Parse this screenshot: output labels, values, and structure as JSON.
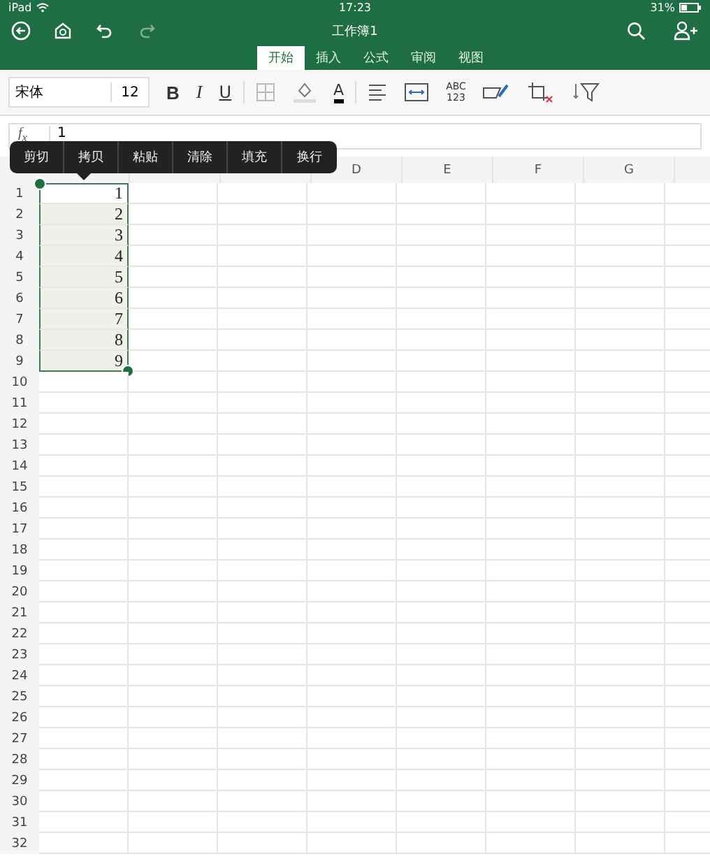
{
  "status_bar": {
    "device": "iPad",
    "time": "17:23",
    "battery": "31%"
  },
  "window": {
    "title": "工作簿1"
  },
  "tabs": [
    {
      "label": "开始",
      "selected": true
    },
    {
      "label": "插入",
      "selected": false
    },
    {
      "label": "公式",
      "selected": false
    },
    {
      "label": "审阅",
      "selected": false
    },
    {
      "label": "视图",
      "selected": false
    }
  ],
  "toolbar": {
    "font": "宋体",
    "size": "12",
    "bold": "B",
    "italic": "I",
    "underline": "U",
    "font_color": "A",
    "number_format": "ABC\n123"
  },
  "formula_bar": {
    "label": "f$_{x}$",
    "value": "1"
  },
  "context_menu": [
    {
      "label": "剪切"
    },
    {
      "label": "拷贝"
    },
    {
      "label": "粘贴"
    },
    {
      "label": "清除"
    },
    {
      "label": "填充"
    },
    {
      "label": "换行"
    }
  ],
  "column_headers": [
    "D",
    "E",
    "F",
    "G"
  ],
  "rows": [
    {
      "label": "1",
      "value": "1",
      "selected": true
    },
    {
      "label": "2",
      "value": "2",
      "selected": true
    },
    {
      "label": "3",
      "value": "3",
      "selected": true
    },
    {
      "label": "4",
      "value": "4",
      "selected": true
    },
    {
      "label": "5",
      "value": "5",
      "selected": true
    },
    {
      "label": "6",
      "value": "6",
      "selected": true
    },
    {
      "label": "7",
      "value": "7",
      "selected": true
    },
    {
      "label": "8",
      "value": "8",
      "selected": true
    },
    {
      "label": "9",
      "value": "9",
      "selected": true
    },
    {
      "label": "10"
    },
    {
      "label": "11"
    },
    {
      "label": "12"
    },
    {
      "label": "13"
    },
    {
      "label": "14"
    },
    {
      "label": "15"
    },
    {
      "label": "16"
    },
    {
      "label": "17"
    },
    {
      "label": "18"
    },
    {
      "label": "19"
    },
    {
      "label": "20"
    },
    {
      "label": "21"
    },
    {
      "label": "22"
    },
    {
      "label": "23"
    },
    {
      "label": "24"
    },
    {
      "label": "25"
    },
    {
      "label": "26"
    },
    {
      "label": "27"
    },
    {
      "label": "28"
    },
    {
      "label": "29"
    },
    {
      "label": "30"
    },
    {
      "label": "31"
    },
    {
      "label": "32"
    }
  ]
}
